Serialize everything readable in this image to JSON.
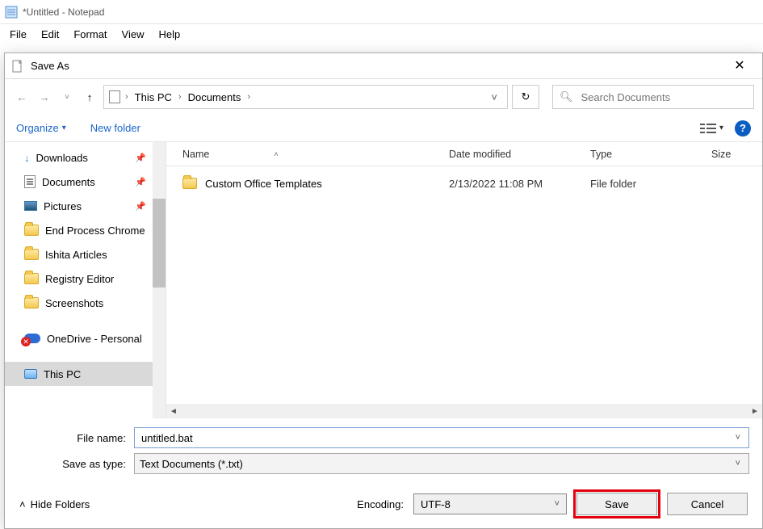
{
  "notepad": {
    "title": "*Untitled - Notepad",
    "menu": [
      "File",
      "Edit",
      "Format",
      "View",
      "Help"
    ]
  },
  "dialog": {
    "title": "Save As",
    "breadcrumb": [
      "This PC",
      "Documents"
    ],
    "search_placeholder": "Search Documents",
    "toolbar": {
      "organize": "Organize",
      "newfolder": "New folder"
    },
    "tree": [
      {
        "label": "Downloads",
        "icon": "download",
        "pinned": true
      },
      {
        "label": "Documents",
        "icon": "document",
        "pinned": true
      },
      {
        "label": "Pictures",
        "icon": "pictures",
        "pinned": true
      },
      {
        "label": "End Process Chrome",
        "icon": "folder"
      },
      {
        "label": "Ishita Articles",
        "icon": "folder"
      },
      {
        "label": "Registry Editor",
        "icon": "folder"
      },
      {
        "label": "Screenshots",
        "icon": "folder"
      },
      {
        "label": "OneDrive - Personal",
        "icon": "onedrive"
      },
      {
        "label": "This PC",
        "icon": "pc",
        "selected": true
      }
    ],
    "columns": {
      "name": "Name",
      "date": "Date modified",
      "type": "Type",
      "size": "Size"
    },
    "rows": [
      {
        "name": "Custom Office Templates",
        "date": "2/13/2022 11:08 PM",
        "type": "File folder"
      }
    ],
    "file_name_label": "File name:",
    "file_name_value": "untitled.bat",
    "save_type_label": "Save as type:",
    "save_type_value": "Text Documents (*.txt)",
    "hide_folders": "Hide Folders",
    "encoding_label": "Encoding:",
    "encoding_value": "UTF-8",
    "save": "Save",
    "cancel": "Cancel"
  }
}
